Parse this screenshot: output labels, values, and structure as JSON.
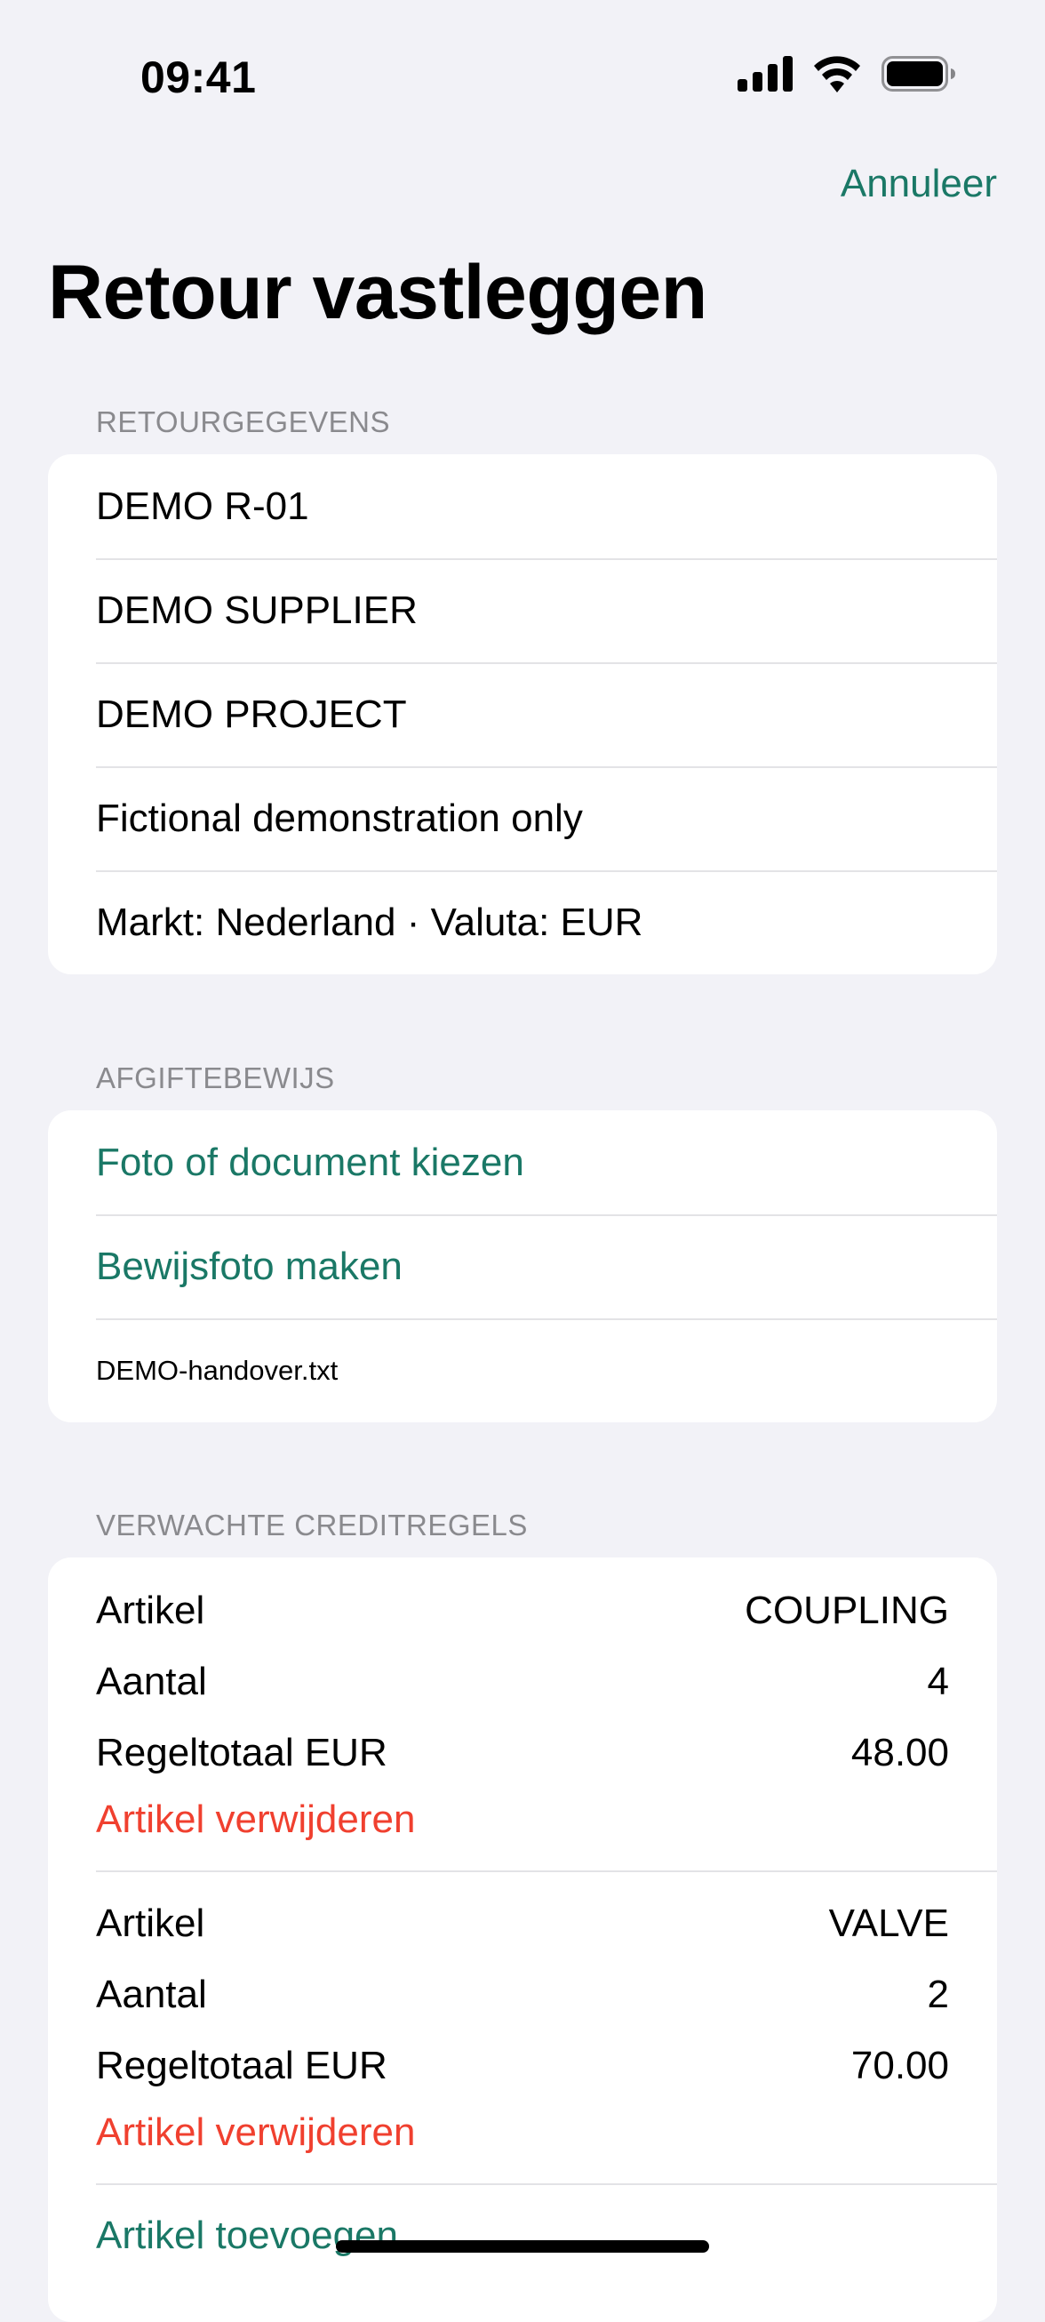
{
  "status_bar": {
    "time": "09:41",
    "icons": [
      "cellular-signal-icon",
      "wifi-icon",
      "battery-icon"
    ]
  },
  "nav": {
    "cancel_label": "Annuleer",
    "title": "Retour vastleggen"
  },
  "colors": {
    "accent": "#1a7866",
    "destructive": "#f0402f",
    "background": "#f2f2f7",
    "card": "#ffffff",
    "secondary_text": "#8a8a8e"
  },
  "return_details": {
    "header": "RETOURGEGEVENS",
    "rows": [
      "DEMO R-01",
      "DEMO SUPPLIER",
      "DEMO PROJECT",
      "Fictional demonstration only",
      "Markt: Nederland · Valuta: EUR"
    ]
  },
  "proof": {
    "header": "AFGIFTEBEWIJS",
    "choose_label": "Foto of document kiezen",
    "capture_label": "Bewijsfoto maken",
    "file_name": "DEMO-handover.txt"
  },
  "credit_lines": {
    "header": "VERWACHTE CREDITREGELS",
    "items": [
      {
        "article_label": "Artikel",
        "article_value": "COUPLING",
        "qty_label": "Aantal",
        "qty_value": "4",
        "total_label": "Regeltotaal EUR",
        "total_value": "48.00",
        "delete_label": "Artikel verwijderen"
      },
      {
        "article_label": "Artikel",
        "article_value": "VALVE",
        "qty_label": "Aantal",
        "qty_value": "2",
        "total_label": "Regeltotaal EUR",
        "total_value": "70.00",
        "delete_label": "Artikel verwijderen"
      }
    ],
    "add_label": "Artikel toevoegen"
  }
}
